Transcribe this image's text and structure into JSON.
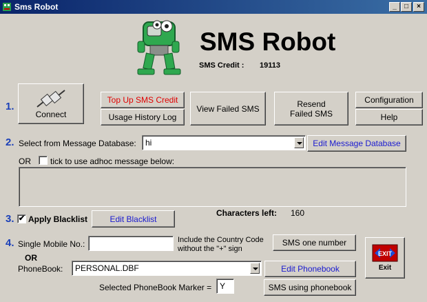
{
  "window": {
    "title": "Sms Robot",
    "minimize": "_",
    "maximize": "□",
    "close": "×"
  },
  "header": {
    "app_name": "SMS Robot",
    "credit_label": "SMS Credit :",
    "credit_value": "19113"
  },
  "steps": {
    "one": "1.",
    "two": "2.",
    "three": "3.",
    "four": "4."
  },
  "toolbar": {
    "connect": "Connect",
    "top_up": "Top Up SMS Credit",
    "usage_history": "Usage History Log",
    "view_failed": "View Failed SMS",
    "resend_failed": "Resend Failed SMS",
    "configuration": "Configuration",
    "help": "Help"
  },
  "message": {
    "select_label": "Select from Message Database:",
    "selected_value": "hi",
    "edit_db": "Edit Message Database",
    "or": "OR",
    "adhoc_label": "tick to use adhoc message below:",
    "adhoc_text": "",
    "chars_left_label": "Characters left:",
    "chars_left_value": "160"
  },
  "blacklist": {
    "label": "Apply Blacklist",
    "checked": "✔",
    "edit": "Edit Blacklist"
  },
  "send": {
    "single_label": "Single Mobile No.:",
    "single_value": "",
    "hint_line1": "Include the Country Code",
    "hint_line2": "without the \"+\" sign",
    "sms_one": "SMS one number",
    "or": "OR",
    "phonebook_label": "PhoneBook:",
    "phonebook_value": "PERSONAL.DBF",
    "edit_phonebook": "Edit Phonebook",
    "marker_label": "Selected PhoneBook Marker =",
    "marker_value": "Y",
    "sms_phonebook": "SMS using phonebook"
  },
  "exit": {
    "sign": "EXIT",
    "label": "Exit"
  },
  "colors": {
    "step_blue": "#1a3fb8",
    "link_blue": "#1a1ad0",
    "alert_red": "#e00000",
    "titlebar": "#0a246a"
  }
}
